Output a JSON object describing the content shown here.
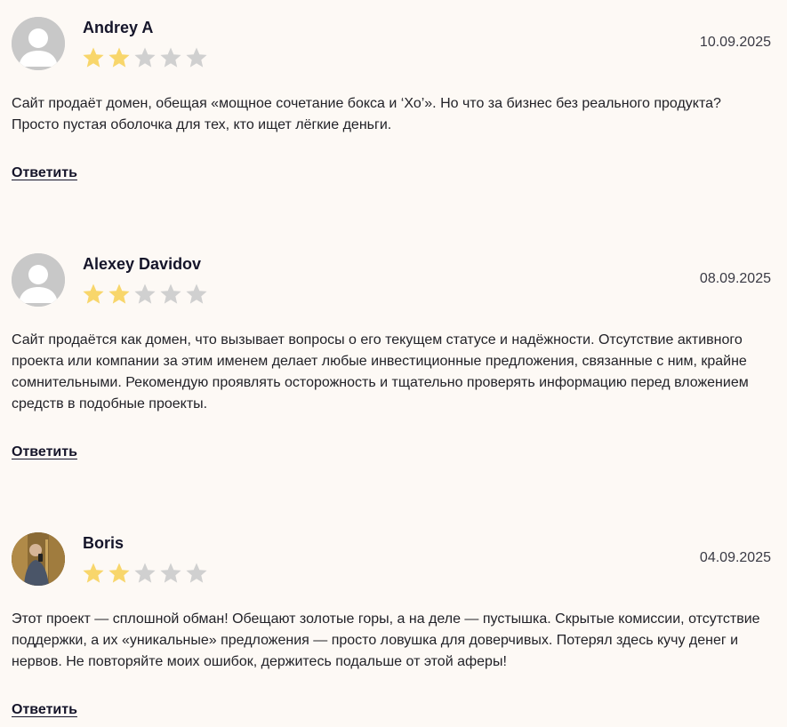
{
  "reply_label": "Ответить",
  "colors": {
    "star_filled": "#f8d66b",
    "star_empty": "#d0d0d0",
    "background": "#fdf9f5"
  },
  "reviews": [
    {
      "author": "Andrey A",
      "date": "10.09.2025",
      "rating": 2,
      "max_rating": 5,
      "avatar": "default-user-icon",
      "text": "Сайт продаёт домен, обещая «мощное сочетание бокса и ‘Хо’». Но что за бизнес без реального продукта? Просто пустая оболочка для тех, кто ищет лёгкие деньги."
    },
    {
      "author": "Alexey Davidov",
      "date": "08.09.2025",
      "rating": 2,
      "max_rating": 5,
      "avatar": "default-user-icon",
      "text": "Сайт продаётся как домен, что вызывает вопросы о его текущем статусе и надёжности. Отсутствие активного проекта или компании за этим именем делает любые инвестиционные предложения, связанные с ним, крайне сомнительными. Рекомендую проявлять осторожность и тщательно проверять информацию перед вложением средств в подобные проекты."
    },
    {
      "author": "Boris",
      "date": "04.09.2025",
      "rating": 2,
      "max_rating": 5,
      "avatar": "user-photo",
      "text": "Этот проект — сплошной обман! Обещают золотые горы, а на деле — пустышка. Скрытые комиссии, отсутствие поддержки, а их «уникальные» предложения — просто ловушка для доверчивых. Потерял здесь кучу денег и нервов. Не повторяйте моих ошибок, держитесь подальше от этой аферы!"
    }
  ]
}
